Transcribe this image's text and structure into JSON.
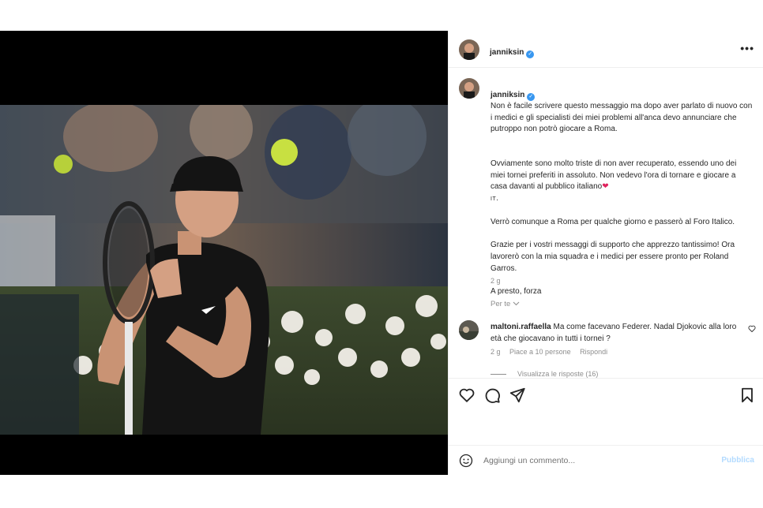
{
  "post": {
    "username": "janniksin",
    "verified_mark": "✓",
    "more_label": "•••"
  },
  "caption": {
    "username": "janniksin",
    "text_p1_rest": "Non è facile scrivere questo messaggio ma dopo aver parlato di nuovo con i medici e gli specialisti dei miei problemi all'anca devo annunciare che putroppo non potrò giocare a Roma.",
    "text_p2": "Ovviamente sono molto triste di non aver recuperato, essendo uno dei miei tornei preferiti in assoluto. Non vedevo l'ora di tornare e giocare a casa davanti al pubblico italiano",
    "text_p2_emoji": "❤",
    "text_p2_flag": "IT",
    "text_p3": "Verrò comunque a Roma per qualche giorno e passerò al Foro Italico.",
    "text_p4": "Grazie per i vostri messaggi di supporto che apprezzo tantissimo! Ora lavorerò con la mia squadra e i medici per essere pronto per Roland Garros.",
    "text_p5": "A presto, forza",
    "age": "2 g"
  },
  "for_you_label": "Per te",
  "comment": {
    "username": "maltoni.raffaella",
    "text": "Ma come facevano Federer. Nadal Djokovic alla loro età che giocavano in tutti i tornei ?",
    "age": "2 g",
    "likes": "Piace a 10 persone",
    "reply_label": "Rispondi",
    "view_replies": "Visualizza le risposte (16)"
  },
  "add_comment": {
    "placeholder": "Aggiungi un commento...",
    "publish_label": "Pubblica"
  },
  "icons": [
    "heart-icon",
    "comment-icon",
    "share-icon",
    "bookmark-icon",
    "emoji-icon",
    "more-icon",
    "verified-icon"
  ],
  "colors": {
    "accent": "#3897f0",
    "publish_disabled": "#b3dbff",
    "secondary_text": "#8e8e8e"
  }
}
